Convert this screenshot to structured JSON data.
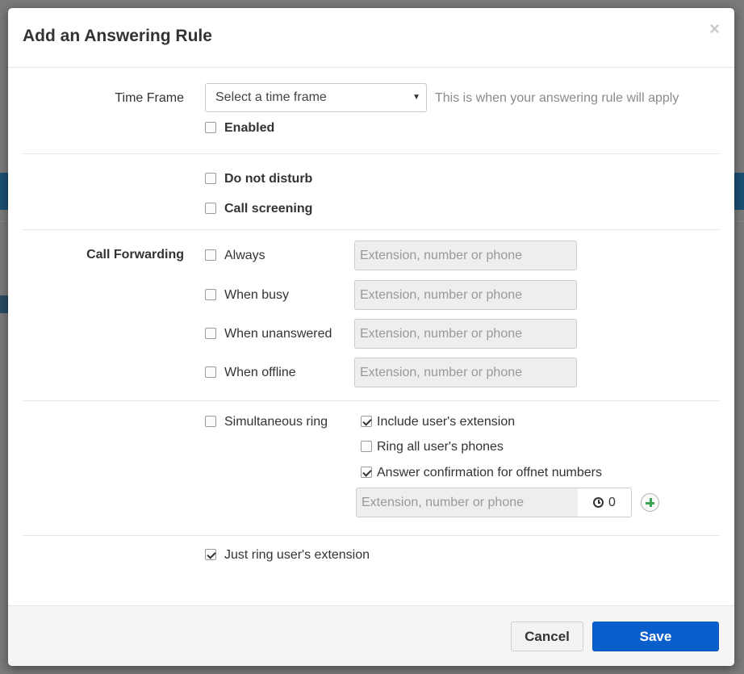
{
  "dialog": {
    "title": "Add an Answering Rule",
    "close_symbol": "×"
  },
  "time_frame": {
    "label": "Time Frame",
    "select_value": "Select a time frame",
    "help": "This is when your answering rule will apply",
    "enabled_label": "Enabled",
    "enabled_checked": false
  },
  "options": {
    "do_not_disturb": {
      "label": "Do not disturb",
      "checked": false
    },
    "call_screening": {
      "label": "Call screening",
      "checked": false
    }
  },
  "call_forwarding": {
    "label": "Call Forwarding",
    "rows": [
      {
        "label": "Always",
        "checked": false,
        "placeholder": "Extension, number or phone"
      },
      {
        "label": "When busy",
        "checked": false,
        "placeholder": "Extension, number or phone"
      },
      {
        "label": "When unanswered",
        "checked": false,
        "placeholder": "Extension, number or phone"
      },
      {
        "label": "When offline",
        "checked": false,
        "placeholder": "Extension, number or phone"
      }
    ]
  },
  "simultaneous_ring": {
    "label": "Simultaneous ring",
    "checked": false,
    "include_ext": {
      "label": "Include user's extension",
      "checked": true
    },
    "ring_all": {
      "label": "Ring all user's phones",
      "checked": false
    },
    "answer_confirm": {
      "label": "Answer confirmation for offnet numbers",
      "checked": true
    },
    "input_placeholder": "Extension, number or phone",
    "timer_value": "0"
  },
  "just_ring": {
    "label": "Just ring user's extension",
    "checked": true
  },
  "footer": {
    "cancel_label": "Cancel",
    "save_label": "Save"
  },
  "colors": {
    "primary": "#0b5fcc",
    "add_green": "#3aa655"
  },
  "icons": {
    "close": "close-icon",
    "caret": "chevron-down-icon",
    "timer": "clock-icon",
    "add": "plus-circle-icon"
  }
}
